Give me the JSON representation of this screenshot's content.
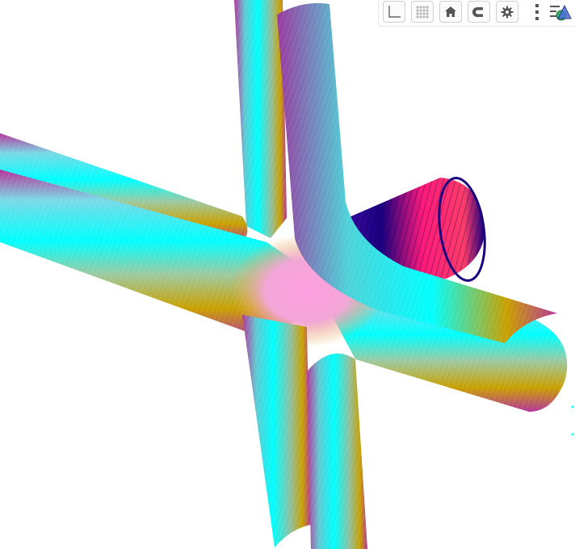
{
  "app": {
    "view": "3d-graphics"
  },
  "toolbar": {
    "buttons": [
      {
        "id": "axes",
        "icon": "axes-icon"
      },
      {
        "id": "grid",
        "icon": "grid-icon"
      },
      {
        "id": "home",
        "icon": "home-icon"
      },
      {
        "id": "snap",
        "icon": "magnet-icon"
      },
      {
        "id": "settings",
        "icon": "gear-icon"
      },
      {
        "id": "more",
        "icon": "more-vertical-icon"
      },
      {
        "id": "styling",
        "icon": "styling-bar-icon"
      }
    ]
  },
  "colors": {
    "cyan": "#00ffff",
    "gold": "#c9a000",
    "magenta": "#b5359c",
    "pink": "#ff1a7a",
    "navy": "#1a0080",
    "toolbar_border": "#d0d0d0",
    "icon_gray": "#666666",
    "icon_green": "#3cb371",
    "icon_blue": "#4a6fd6"
  }
}
